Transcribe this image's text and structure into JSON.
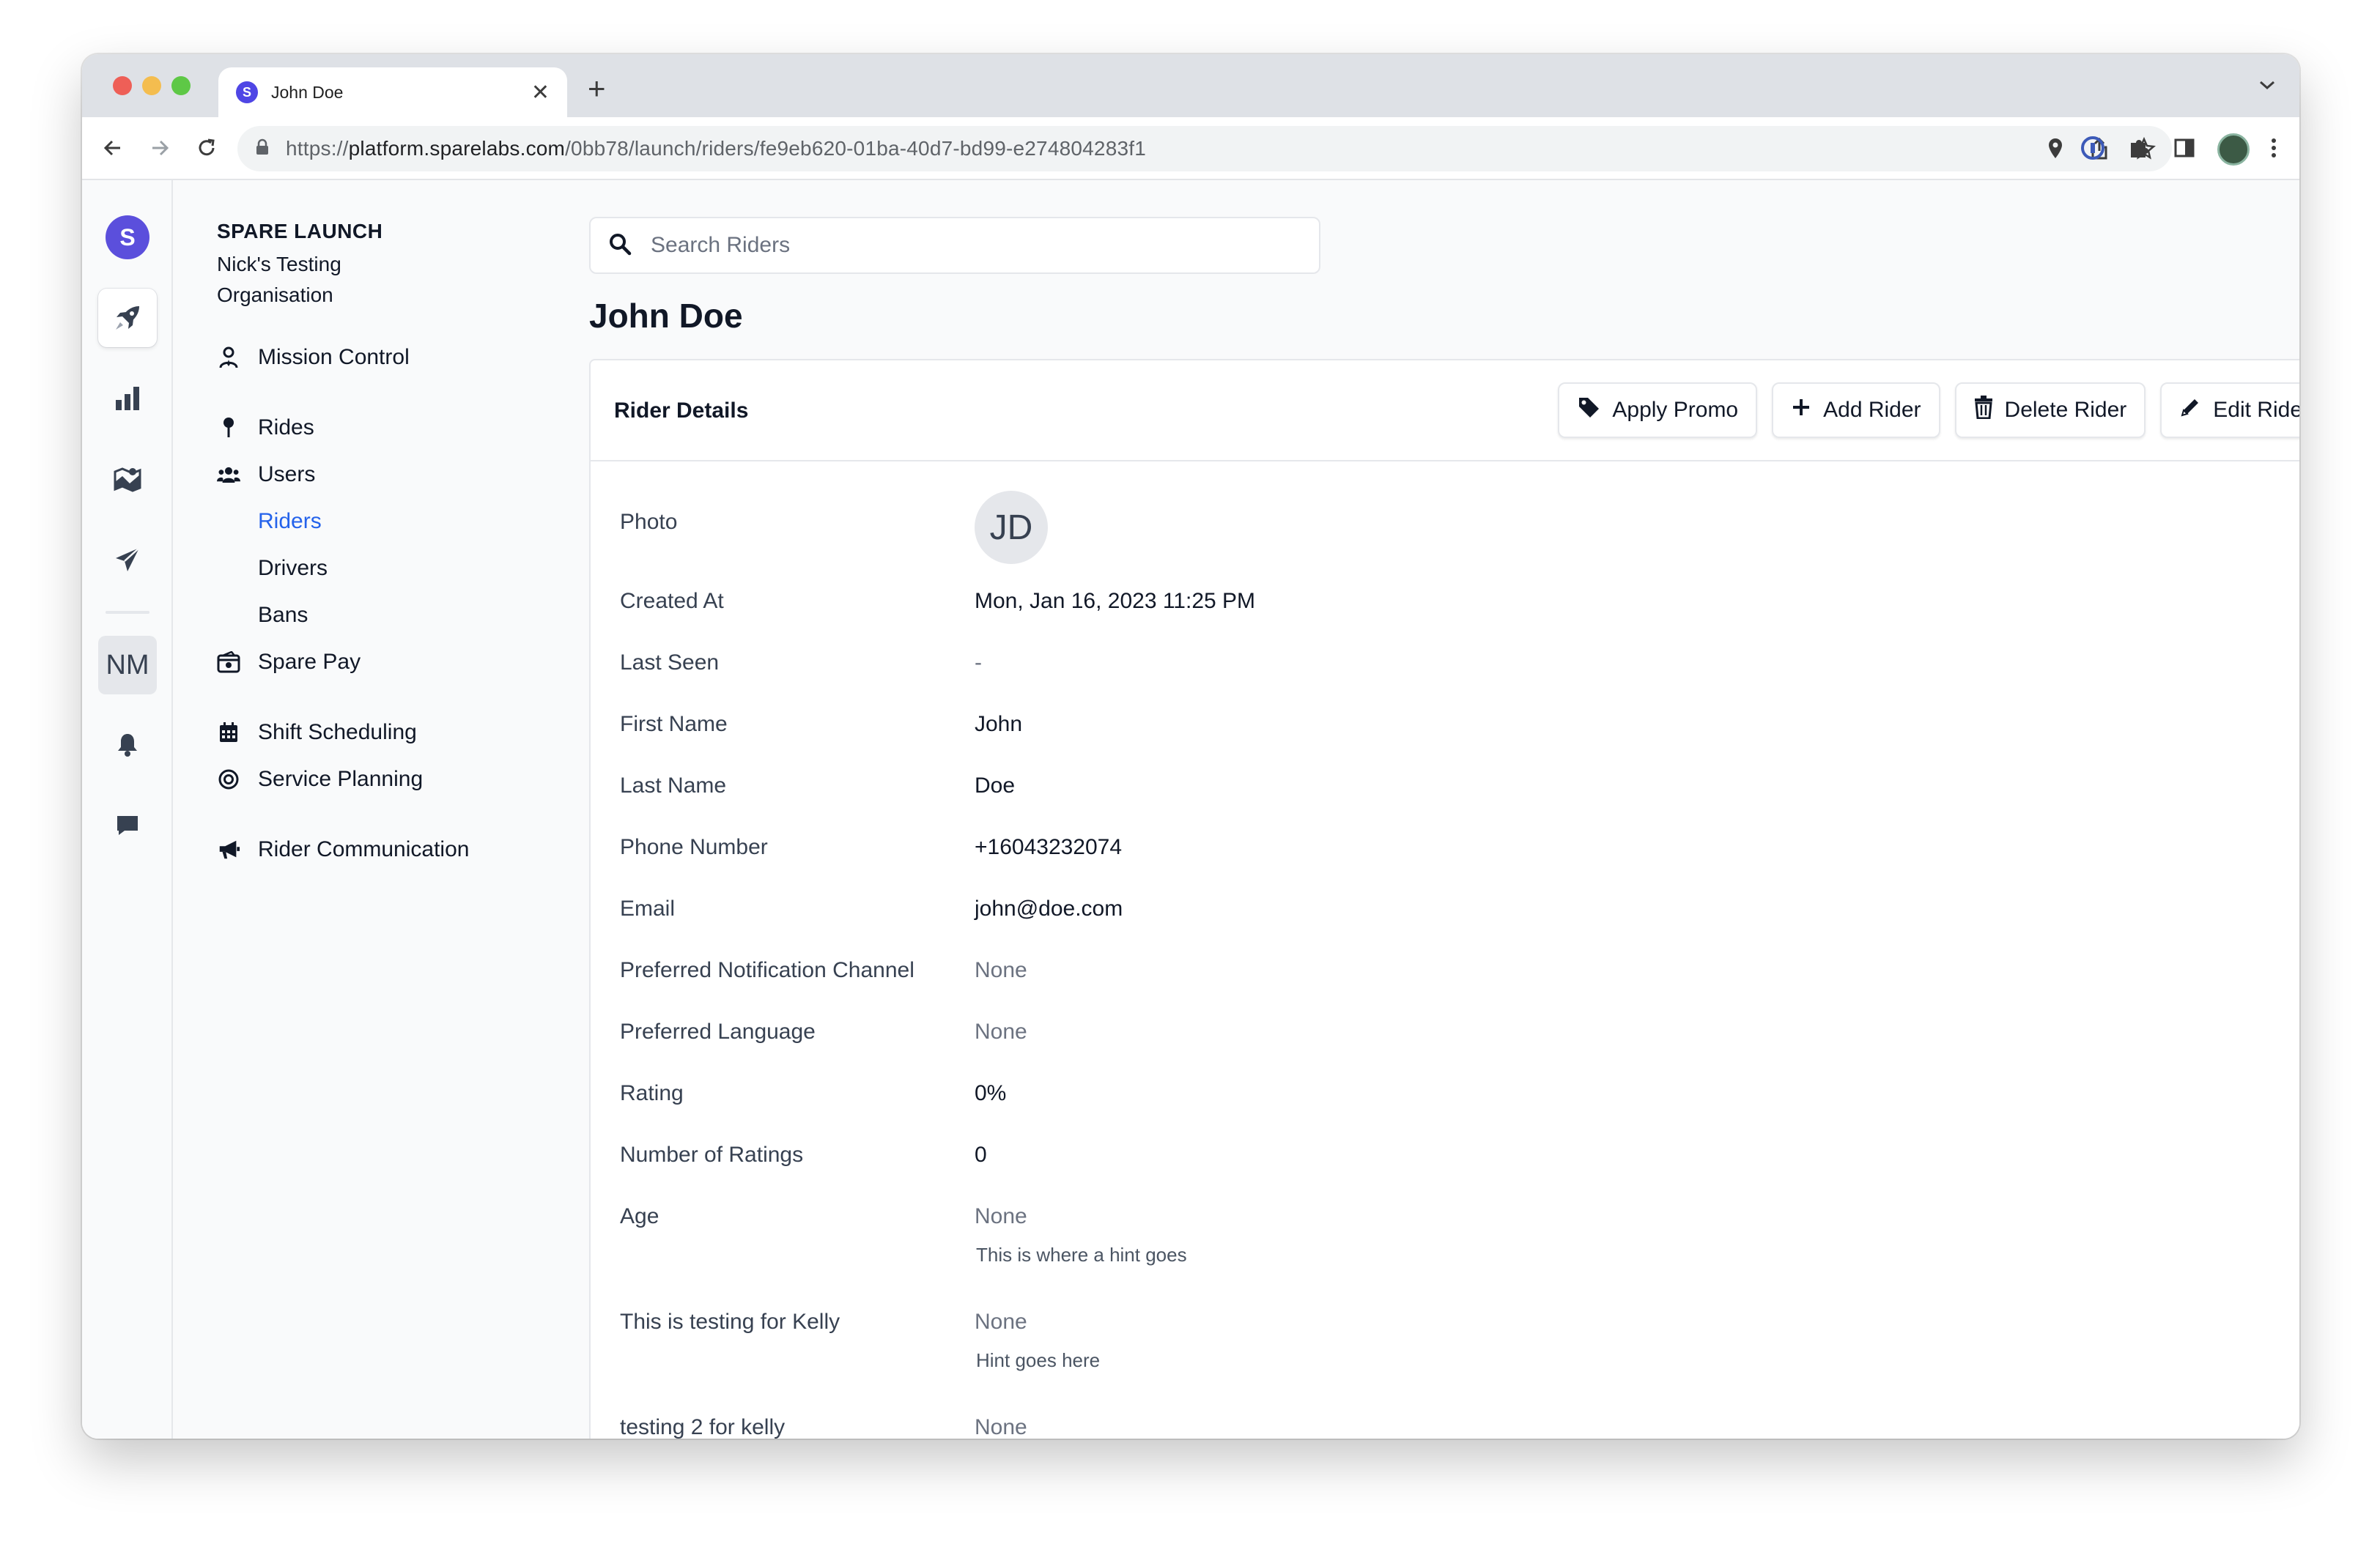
{
  "browser": {
    "tab_title": "John Doe",
    "tab_favicon_letter": "S",
    "url_prefix": "https://",
    "url_domain": "platform.sparelabs.com",
    "url_path": "/0bb78/launch/riders/fe9eb620-01ba-40d7-bd99-e274804283f1"
  },
  "rail": {
    "logo_letter": "S",
    "user_initials": "NM",
    "items": [
      "rocket-icon",
      "bar-chart-icon",
      "map-icon",
      "paper-plane-icon",
      "bell-icon",
      "chat-icon"
    ]
  },
  "sidebar": {
    "brand": "SPARE LAUNCH",
    "org": "Nick's Testing Organisation",
    "items": {
      "mission_control": "Mission Control",
      "rides": "Rides",
      "users": "Users",
      "riders": "Riders",
      "drivers": "Drivers",
      "bans": "Bans",
      "spare_pay": "Spare Pay",
      "shift_scheduling": "Shift Scheduling",
      "service_planning": "Service Planning",
      "rider_communication": "Rider Communication"
    }
  },
  "search": {
    "placeholder": "Search Riders"
  },
  "page": {
    "title": "John Doe"
  },
  "card": {
    "title": "Rider Details",
    "actions": {
      "apply_promo": "Apply Promo",
      "add_rider": "Add Rider",
      "delete_rider": "Delete Rider",
      "edit_rider": "Edit Rider"
    }
  },
  "details": {
    "photo_label": "Photo",
    "photo_initials": "JD",
    "created_at": {
      "label": "Created At",
      "value": "Mon, Jan 16, 2023 11:25 PM"
    },
    "last_seen": {
      "label": "Last Seen",
      "value": "-"
    },
    "first_name": {
      "label": "First Name",
      "value": "John"
    },
    "last_name": {
      "label": "Last Name",
      "value": "Doe"
    },
    "phone": {
      "label": "Phone Number",
      "value": "+16043232074"
    },
    "email": {
      "label": "Email",
      "value": "john@doe.com"
    },
    "notification_channel": {
      "label": "Preferred Notification Channel",
      "value": "None"
    },
    "language": {
      "label": "Preferred Language",
      "value": "None"
    },
    "rating": {
      "label": "Rating",
      "value": "0%"
    },
    "num_ratings": {
      "label": "Number of Ratings",
      "value": "0"
    },
    "age": {
      "label": "Age",
      "value": "None",
      "hint": "This is where a hint goes"
    },
    "kelly1": {
      "label": "This is testing for Kelly",
      "value": "None",
      "hint": "Hint goes here"
    },
    "kelly2": {
      "label": "testing 2 for kelly",
      "value": "None"
    }
  },
  "colors": {
    "accent": "#2563eb",
    "brand": "#5b4fdc"
  }
}
